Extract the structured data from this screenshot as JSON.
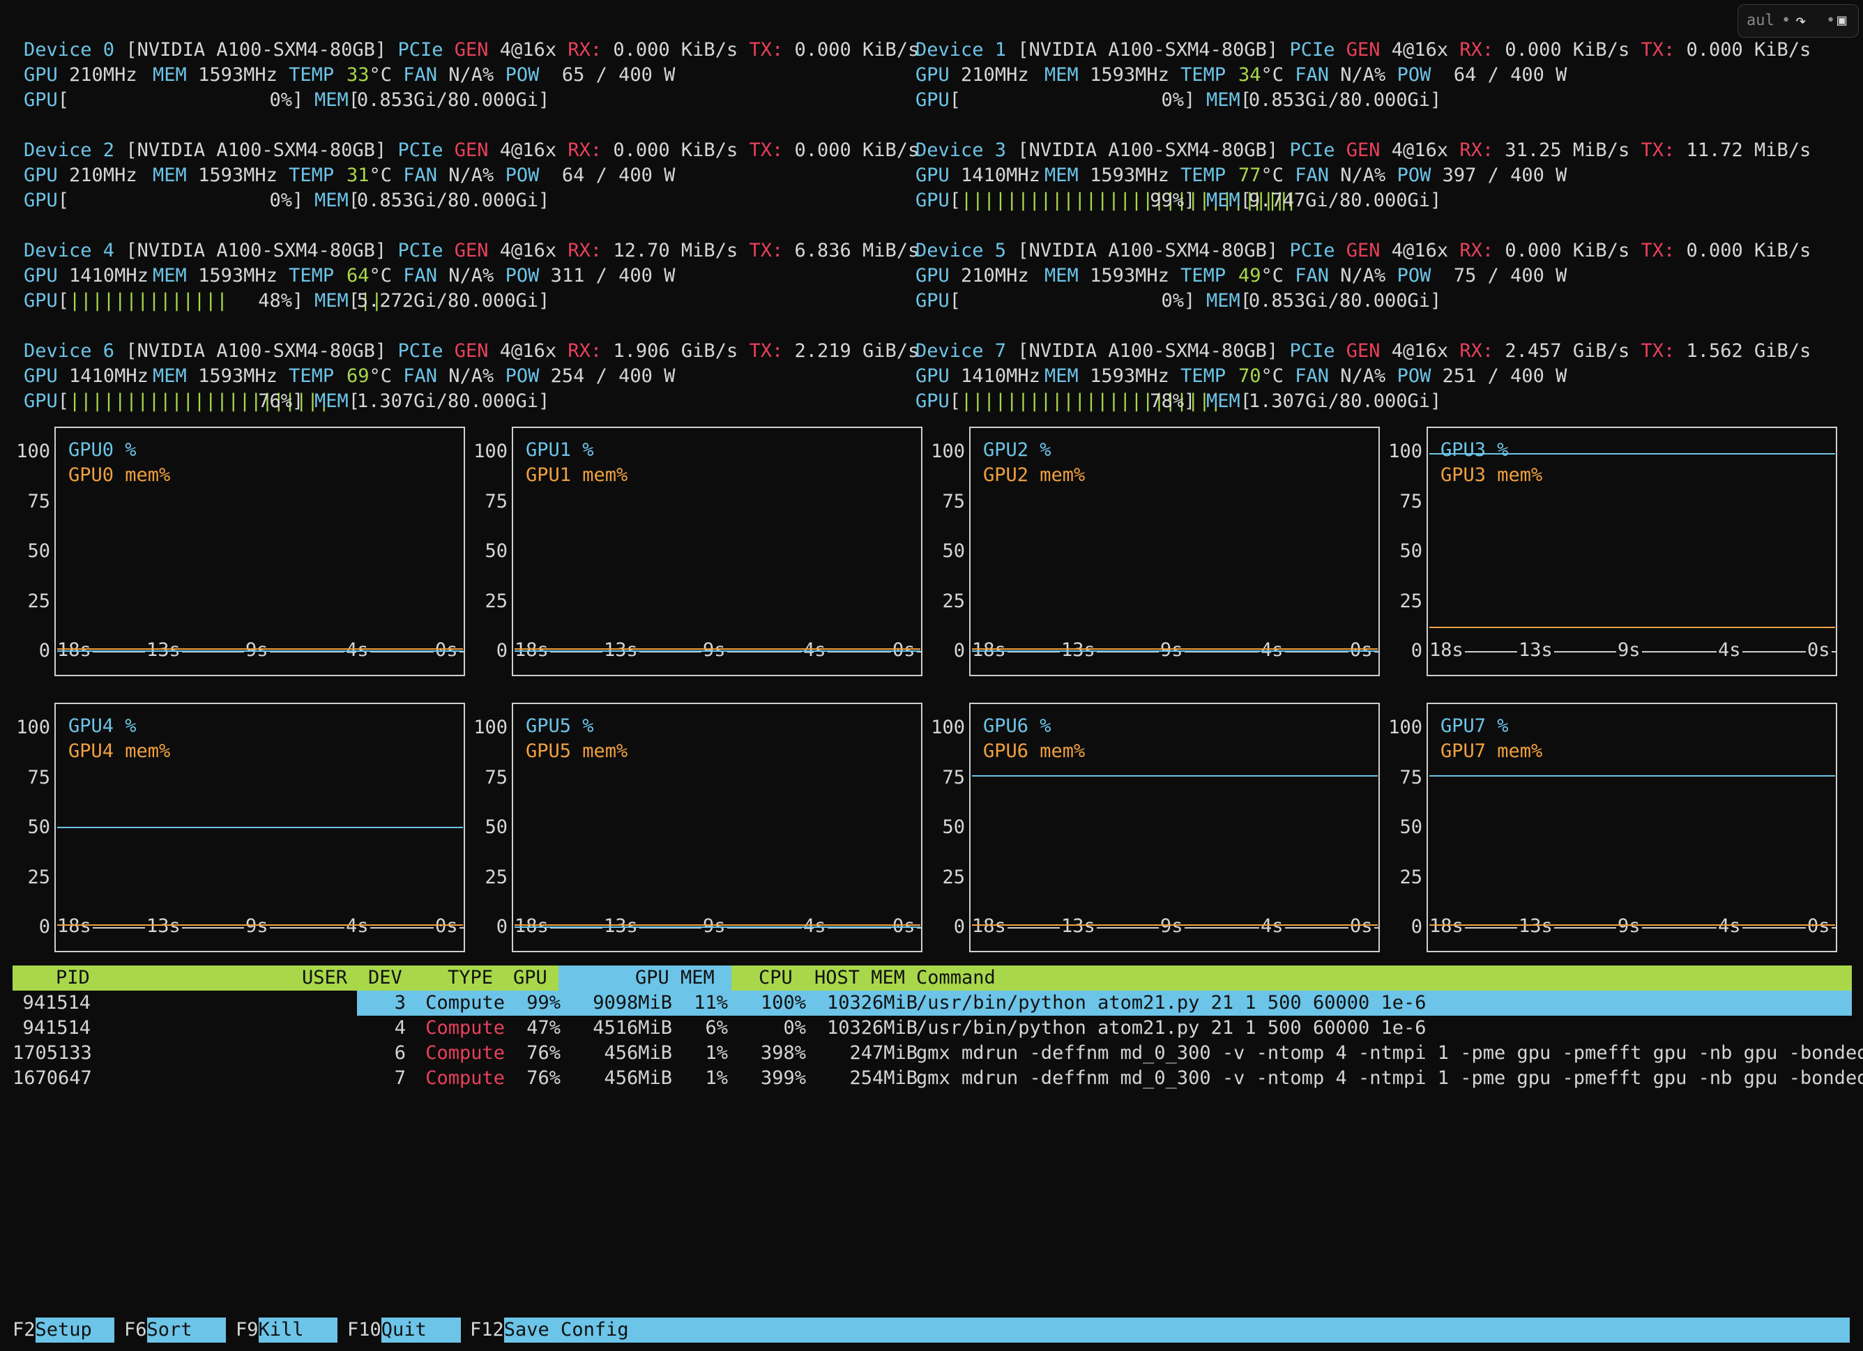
{
  "toolbar": {
    "input_text": "aul",
    "dot": "•",
    "share_icon": "↷",
    "panel_icon": "▣"
  },
  "devices": [
    {
      "head": "Device 0",
      "model": "[NVIDIA A100-SXM4-80GB]",
      "pcie": "4@16x",
      "rx": "0.000 KiB/s",
      "tx": "0.000 KiB/s",
      "gpu_clk": "210MHz",
      "mem_clk": "1593MHz",
      "temp": "33",
      "fan": "N/A%",
      "pow": " 65 / 400 W",
      "util": "0%",
      "util_bars": 0,
      "mem_bars": 0,
      "mem": "0.853Gi/80.000Gi"
    },
    {
      "head": "Device 1",
      "model": "[NVIDIA A100-SXM4-80GB]",
      "pcie": "4@16x",
      "rx": "0.000 KiB/s",
      "tx": "0.000 KiB/s",
      "gpu_clk": "210MHz",
      "mem_clk": "1593MHz",
      "temp": "34",
      "fan": "N/A%",
      "pow": " 64 / 400 W",
      "util": "0%",
      "util_bars": 0,
      "mem_bars": 0,
      "mem": "0.853Gi/80.000Gi"
    },
    {
      "head": "Device 2",
      "model": "[NVIDIA A100-SXM4-80GB]",
      "pcie": "4@16x",
      "rx": "0.000 KiB/s",
      "tx": "0.000 KiB/s",
      "gpu_clk": "210MHz",
      "mem_clk": "1593MHz",
      "temp": "31",
      "fan": "N/A%",
      "pow": " 64 / 400 W",
      "util": "0%",
      "util_bars": 0,
      "mem_bars": 0,
      "mem": "0.853Gi/80.000Gi"
    },
    {
      "head": "Device 3",
      "model": "[NVIDIA A100-SXM4-80GB]",
      "pcie": "4@16x",
      "rx": "31.25 MiB/s",
      "tx": "11.72 MiB/s",
      "gpu_clk": "1410MHz",
      "mem_clk": "1593MHz",
      "temp": "77",
      "fan": "N/A%",
      "pow": "397 / 400 W",
      "util": "99%",
      "util_bars": 29,
      "mem_bars": 4,
      "mem": "9.747Gi/80.000Gi"
    },
    {
      "head": "Device 4",
      "model": "[NVIDIA A100-SXM4-80GB]",
      "pcie": "4@16x",
      "rx": "12.70 MiB/s",
      "tx": "6.836 MiB/s",
      "gpu_clk": "1410MHz",
      "mem_clk": "1593MHz",
      "temp": "64",
      "fan": "N/A%",
      "pow": "311 / 400 W",
      "util": "48%",
      "util_bars": 14,
      "mem_bars": 2,
      "mem": "5.272Gi/80.000Gi"
    },
    {
      "head": "Device 5",
      "model": "[NVIDIA A100-SXM4-80GB]",
      "pcie": "4@16x",
      "rx": "0.000 KiB/s",
      "tx": "0.000 KiB/s",
      "gpu_clk": "210MHz",
      "mem_clk": "1593MHz",
      "temp": "49",
      "fan": "N/A%",
      "pow": " 75 / 400 W",
      "util": "0%",
      "util_bars": 0,
      "mem_bars": 0,
      "mem": "0.853Gi/80.000Gi"
    },
    {
      "head": "Device 6",
      "model": "[NVIDIA A100-SXM4-80GB]",
      "pcie": "4@16x",
      "rx": "1.906 GiB/s",
      "tx": "2.219 GiB/s",
      "gpu_clk": "1410MHz",
      "mem_clk": "1593MHz",
      "temp": "69",
      "fan": "N/A%",
      "pow": "254 / 400 W",
      "util": "76%",
      "util_bars": 23,
      "mem_bars": 0,
      "mem": "1.307Gi/80.000Gi"
    },
    {
      "head": "Device 7",
      "model": "[NVIDIA A100-SXM4-80GB]",
      "pcie": "4@16x",
      "rx": "2.457 GiB/s",
      "tx": "1.562 GiB/s",
      "gpu_clk": "1410MHz",
      "mem_clk": "1593MHz",
      "temp": "70",
      "fan": "N/A%",
      "pow": "251 / 400 W",
      "util": "78%",
      "util_bars": 23,
      "mem_bars": 0,
      "mem": "1.307Gi/80.000Gi"
    }
  ],
  "labels": {
    "pcie": "PCIe",
    "gen": "GEN",
    "rx": "RX:",
    "tx": "TX:",
    "gpu": "GPU",
    "mem": "MEM",
    "temp": "TEMP",
    "deg": "°C",
    "fan": "FAN",
    "pow": "POW"
  },
  "chart_data": [
    {
      "type": "line",
      "title": "GPU0",
      "series": [
        {
          "name": "GPU0 %",
          "values": [
            0,
            0
          ]
        },
        {
          "name": "GPU0 mem%",
          "values": [
            1,
            1
          ]
        }
      ],
      "x": [
        "18s",
        "13s",
        "9s",
        "4s",
        "0s"
      ],
      "yticks": [
        100,
        75,
        50,
        25,
        0
      ],
      "ylim": [
        0,
        100
      ]
    },
    {
      "type": "line",
      "title": "GPU1",
      "series": [
        {
          "name": "GPU1 %",
          "values": [
            0,
            0
          ]
        },
        {
          "name": "GPU1 mem%",
          "values": [
            1,
            1
          ]
        }
      ],
      "x": [
        "18s",
        "13s",
        "9s",
        "4s",
        "0s"
      ],
      "yticks": [
        100,
        75,
        50,
        25,
        0
      ],
      "ylim": [
        0,
        100
      ]
    },
    {
      "type": "line",
      "title": "GPU2",
      "series": [
        {
          "name": "GPU2 %",
          "values": [
            0,
            0
          ]
        },
        {
          "name": "GPU2 mem%",
          "values": [
            1,
            1
          ]
        }
      ],
      "x": [
        "18s",
        "13s",
        "9s",
        "4s",
        "0s"
      ],
      "yticks": [
        100,
        75,
        50,
        25,
        0
      ],
      "ylim": [
        0,
        100
      ]
    },
    {
      "type": "line",
      "title": "GPU3",
      "series": [
        {
          "name": "GPU3 %",
          "values": [
            99,
            99
          ]
        },
        {
          "name": "GPU3 mem%",
          "values": [
            12,
            12
          ]
        }
      ],
      "x": [
        "18s",
        "13s",
        "9s",
        "4s",
        "0s"
      ],
      "yticks": [
        100,
        75,
        50,
        25,
        0
      ],
      "ylim": [
        0,
        100
      ]
    },
    {
      "type": "line",
      "title": "GPU4",
      "series": [
        {
          "name": "GPU4 %",
          "values": [
            50,
            50
          ]
        },
        {
          "name": "GPU4 mem%",
          "values": [
            1,
            1
          ]
        }
      ],
      "x": [
        "18s",
        "13s",
        "9s",
        "4s",
        "0s"
      ],
      "yticks": [
        100,
        75,
        50,
        25,
        0
      ],
      "ylim": [
        0,
        100
      ]
    },
    {
      "type": "line",
      "title": "GPU5",
      "series": [
        {
          "name": "GPU5 %",
          "values": [
            0,
            0
          ]
        },
        {
          "name": "GPU5 mem%",
          "values": [
            1,
            1
          ]
        }
      ],
      "x": [
        "18s",
        "13s",
        "9s",
        "4s",
        "0s"
      ],
      "yticks": [
        100,
        75,
        50,
        25,
        0
      ],
      "ylim": [
        0,
        100
      ]
    },
    {
      "type": "line",
      "title": "GPU6",
      "series": [
        {
          "name": "GPU6 %",
          "values": [
            76,
            76
          ]
        },
        {
          "name": "GPU6 mem%",
          "values": [
            1,
            1
          ]
        }
      ],
      "x": [
        "18s",
        "13s",
        "9s",
        "4s",
        "0s"
      ],
      "yticks": [
        100,
        75,
        50,
        25,
        0
      ],
      "ylim": [
        0,
        100
      ]
    },
    {
      "type": "line",
      "title": "GPU7",
      "series": [
        {
          "name": "GPU7 %",
          "values": [
            76,
            76
          ]
        },
        {
          "name": "GPU7 mem%",
          "values": [
            1,
            1
          ]
        }
      ],
      "x": [
        "18s",
        "13s",
        "9s",
        "4s",
        "0s"
      ],
      "yticks": [
        100,
        75,
        50,
        25,
        0
      ],
      "ylim": [
        0,
        100
      ]
    }
  ],
  "table": {
    "headers": {
      "pid": "PID",
      "user": "USER",
      "dev": "DEV",
      "type": "TYPE",
      "gpu": "GPU",
      "gpu_mem": "GPU MEM",
      "cpu": "CPU",
      "host_mem": "HOST MEM",
      "command": "Command"
    },
    "rows": [
      {
        "pid": "941514",
        "user": "",
        "dev": "3",
        "type": "Compute",
        "gpu": "99%",
        "gpu_mem": "9098MiB",
        "gpu_mem_pct": "11%",
        "cpu": "100%",
        "host_mem": "10326MiB",
        "command": "/usr/bin/python atom21.py 21 1 500 60000 1e-6"
      },
      {
        "pid": "941514",
        "user": "",
        "dev": "4",
        "type": "Compute",
        "gpu": "47%",
        "gpu_mem": "4516MiB",
        "gpu_mem_pct": "6%",
        "cpu": "0%",
        "host_mem": "10326MiB",
        "command": "/usr/bin/python atom21.py 21 1 500 60000 1e-6"
      },
      {
        "pid": "1705133",
        "user": "",
        "dev": "6",
        "type": "Compute",
        "gpu": "76%",
        "gpu_mem": "456MiB",
        "gpu_mem_pct": "1%",
        "cpu": "398%",
        "host_mem": "247MiB",
        "command": "gmx mdrun -deffnm md_0_300 -v -ntomp 4 -ntmpi 1 -pme gpu -pmefft gpu -nb gpu -bonded"
      },
      {
        "pid": "1670647",
        "user": "",
        "dev": "7",
        "type": "Compute",
        "gpu": "76%",
        "gpu_mem": "456MiB",
        "gpu_mem_pct": "1%",
        "cpu": "399%",
        "host_mem": "254MiB",
        "command": "gmx mdrun -deffnm md_0_300 -v -ntomp 4 -ntmpi 1 -pme gpu -pmefft gpu -nb gpu -bonded"
      }
    ]
  },
  "footer": [
    {
      "key": "F2",
      "label": "Setup  "
    },
    {
      "key": "F6",
      "label": "Sort   "
    },
    {
      "key": "F9",
      "label": "Kill   "
    },
    {
      "key": "F10",
      "label": "Quit   "
    },
    {
      "key": "F12",
      "label": "Save Config"
    }
  ],
  "colors": {
    "bg": "#0c0c0c",
    "cyan": "#6cc4e8",
    "red": "#e8405a",
    "green": "#a8d84a",
    "orange": "#f0a040"
  }
}
